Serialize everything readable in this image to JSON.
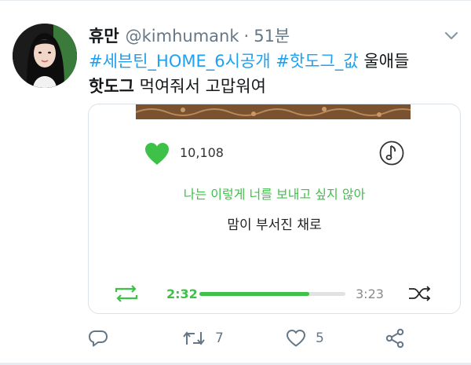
{
  "tweet": {
    "display_name": "휴만",
    "handle": "@kimhumank",
    "separator": "·",
    "time": "51분",
    "text_parts": {
      "hashtag_1": "#세븐틴_HOME_6시공개",
      "hashtag_2": "#핫도그_값",
      "trailing_line1": "울애들",
      "line2_bold": "핫도그",
      "line2_rest": "먹여줘서 고맙워여"
    }
  },
  "music_card": {
    "like_count": "10,108",
    "lyric_current": "나는 이렇게 너를 보내고 싶지 않아",
    "lyric_next": "맘이 부서진 채로",
    "elapsed": "2:32",
    "duration": "3:23",
    "progress_fraction": 0.75
  },
  "actions": {
    "reply_count": "",
    "retweet_count": "7",
    "like_count": "5"
  },
  "colors": {
    "accent_green": "#3dc149",
    "twitter_blue": "#1da1f2",
    "muted_gray": "#657786"
  },
  "icons": {
    "caret": "chevron-down-icon",
    "heart": "heart-icon",
    "music": "music-note-icon",
    "repeat": "repeat-icon",
    "shuffle": "shuffle-icon",
    "reply": "reply-icon",
    "retweet": "retweet-icon",
    "like": "like-icon",
    "share": "share-icon"
  }
}
